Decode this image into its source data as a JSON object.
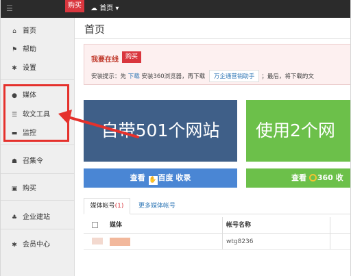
{
  "topbar": {
    "buy_label": "购买",
    "home_label": "首页",
    "home_icon": "cloud-icon"
  },
  "sidebar": {
    "items": [
      {
        "label": "首页",
        "icon": "home-icon"
      },
      {
        "label": "帮助",
        "icon": "flag-icon"
      },
      {
        "label": "设置",
        "icon": "gear-icon"
      },
      {
        "label": "媒体",
        "icon": "map-marker-icon"
      },
      {
        "label": "软文工具",
        "icon": "list-icon"
      },
      {
        "label": "监控",
        "icon": "monitor-icon"
      },
      {
        "label": "召集令",
        "icon": "users-icon"
      },
      {
        "label": "购买",
        "icon": "briefcase-icon"
      },
      {
        "label": "企业建站",
        "icon": "sitemap-icon"
      },
      {
        "label": "会员中心",
        "icon": "gear-icon"
      }
    ]
  },
  "main": {
    "title": "首页",
    "notice": {
      "title": "我要在线",
      "buy_label": "购买",
      "tip_prefix": "安装提示：先 ",
      "tip_download1": "下载",
      "tip_middle1": " 安装360浏览器，再下载 ",
      "tip_assistant": "万企通营销助手",
      "tip_middle2": "；最后，将下载的文",
      "tip_suffix": ""
    },
    "banners": [
      {
        "text": "自带501个网站",
        "color": "#3f5f88"
      },
      {
        "text": "使用2个网",
        "color": "#6cc04a"
      }
    ],
    "buttons": {
      "baidu_prefix": "查看",
      "baidu_logo": "百度",
      "baidu_suffix": "收录",
      "s360_prefix": "查看",
      "s360_text": "360 收"
    },
    "tabs": {
      "media_label": "媒体帐号",
      "media_count": "(1)",
      "more_label": "更多媒体帐号"
    },
    "table": {
      "headers": [
        "媒体",
        "帐号名称"
      ],
      "rows": [
        {
          "account": "wtg8236"
        }
      ]
    }
  },
  "colors": {
    "accent_red": "#e5312c",
    "banner_blue": "#3f5f88",
    "banner_green": "#6cc04a",
    "button_blue": "#4a86d4"
  }
}
